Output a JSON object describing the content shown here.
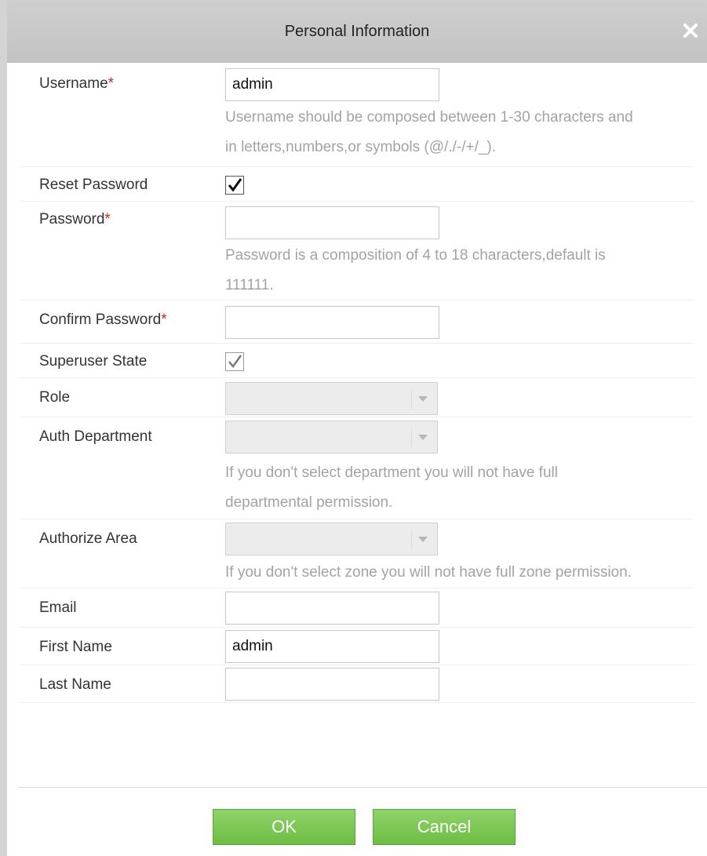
{
  "dialog": {
    "title": "Personal Information",
    "close_glyph": "✕"
  },
  "form": {
    "username": {
      "label": "Username",
      "required_mark": "*",
      "value": "admin",
      "hint_line1": "Username should be composed between 1-30 characters and",
      "hint_line2": "in letters,numbers,or symbols (@/./-/+/_)."
    },
    "reset_password": {
      "label": "Reset Password",
      "checked": true
    },
    "password": {
      "label": "Password",
      "required_mark": "*",
      "value": "",
      "hint_line1": "Password is a composition of 4 to 18 characters,default is",
      "hint_line2": "111111."
    },
    "confirm_password": {
      "label": "Confirm Password",
      "required_mark": "*",
      "value": ""
    },
    "superuser_state": {
      "label": "Superuser State",
      "checked": true,
      "disabled": true
    },
    "role": {
      "label": "Role",
      "value": ""
    },
    "auth_department": {
      "label": "Auth Department",
      "value": "",
      "hint_line1": "If you don't select department you will not have full",
      "hint_line2": "departmental permission."
    },
    "authorize_area": {
      "label": "Authorize Area",
      "value": "",
      "hint": "If you don't select zone you will not have full zone permission."
    },
    "email": {
      "label": "Email",
      "value": ""
    },
    "first_name": {
      "label": "First Name",
      "value": "admin"
    },
    "last_name": {
      "label": "Last Name",
      "value": ""
    }
  },
  "buttons": {
    "ok": "OK",
    "cancel": "Cancel"
  },
  "colors": {
    "button_green": "#7bc74f",
    "required_red": "#e02020",
    "hint_grey": "#a3a3a3",
    "titlebar_grey": "#c9c9c9"
  }
}
